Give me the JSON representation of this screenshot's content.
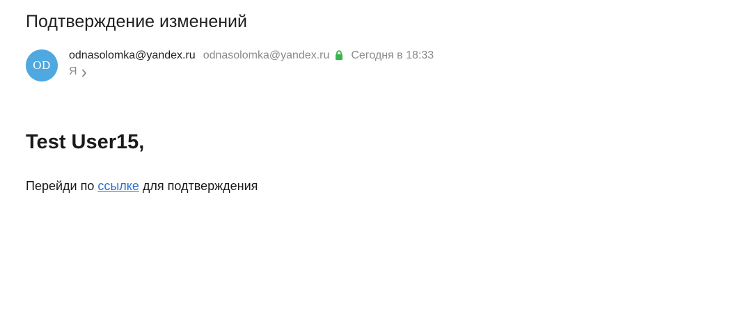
{
  "subject": "Подтверждение изменений",
  "sender": {
    "avatar_initials": "OD",
    "avatar_color": "#4fa8df",
    "name": "odnasolomka@yandex.ru",
    "email": "odnasolomka@yandex.ru",
    "verified_icon": "lock-icon",
    "verified_color": "#3ab54a",
    "date": "Сегодня в 18:33"
  },
  "recipient": {
    "label": "Я",
    "expand_icon": "chevron-right-icon"
  },
  "body": {
    "greeting": "Test User15,",
    "text_before_link": "Перейди по ",
    "link_text": "ссылке",
    "text_after_link": " для подтверждения",
    "link_color": "#2a6fd1"
  }
}
